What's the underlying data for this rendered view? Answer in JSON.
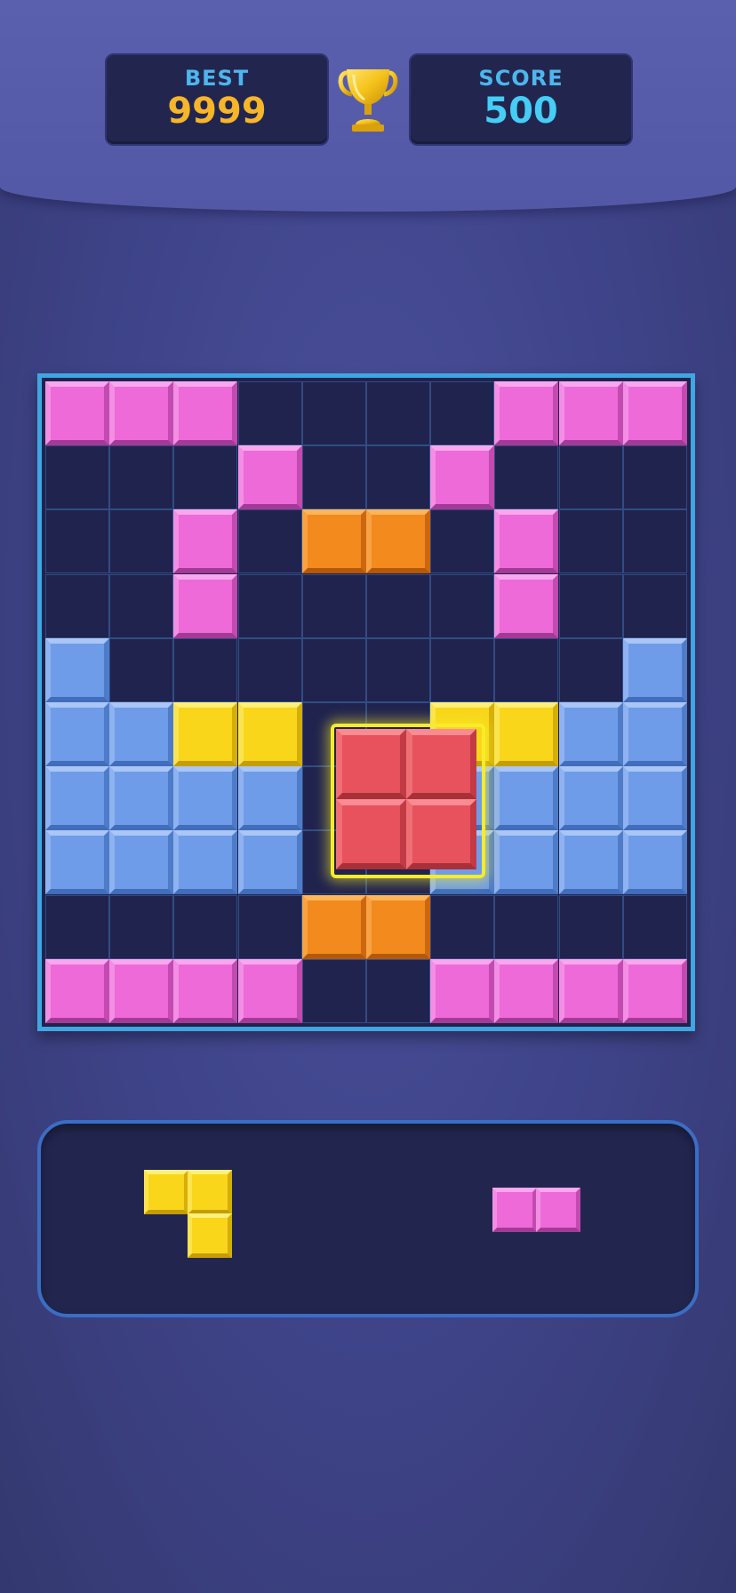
{
  "header": {
    "best_label": "BEST",
    "best_value": "9999",
    "score_label": "SCORE",
    "score_value": "500",
    "trophy_icon": "trophy-icon"
  },
  "colors": {
    "pink": "#ee6ad9",
    "orange": "#f28a1e",
    "blue": "#6f9ce9",
    "yellow": "#f9d61a",
    "red": "#e8525c",
    "board_border": "#3fa6e3",
    "highlight": "#f6ec2a"
  },
  "board": {
    "rows": 10,
    "cols": 10,
    "cells": [
      "PPP....PPP",
      "...P..P...",
      "..P.OO.P..",
      "..P....P..",
      "B........B",
      "BBYY..YYBB",
      "BBBB..BBBB",
      "BBBB..BBBB",
      "....OO....",
      "PPPP..PPPP"
    ],
    "legend": {
      "P": "pink",
      "O": "orange",
      "B": "blue",
      "Y": "yellow"
    }
  },
  "held_piece": {
    "color": "red",
    "shape": [
      "XX",
      "XX"
    ]
  },
  "tray": {
    "pieces": [
      {
        "name": "yellow-corner-piece",
        "color": "yellow",
        "shape": [
          "XX",
          ".X"
        ]
      },
      {
        "name": "pink-domino-piece",
        "color": "pink",
        "shape": [
          "XX"
        ]
      }
    ]
  }
}
